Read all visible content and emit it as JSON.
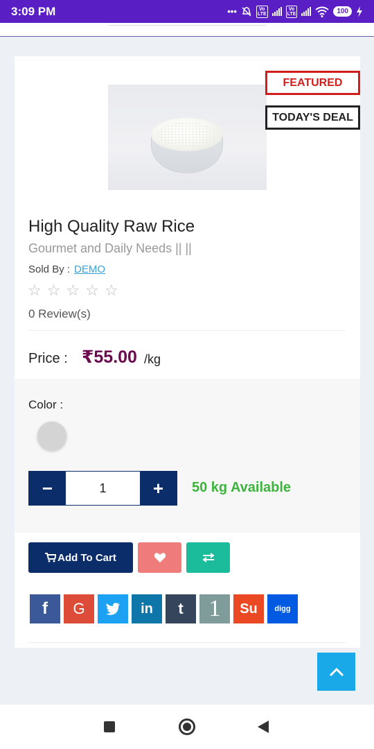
{
  "status_bar": {
    "time": "3:09 PM",
    "battery": "100",
    "volte_1": "Vo LTE",
    "volte_2": "Vo LTE",
    "icons": [
      "more-dots-icon",
      "mute-icon",
      "signal-icon",
      "signal-icon",
      "wifi-icon",
      "battery-icon",
      "charging-icon"
    ]
  },
  "product": {
    "image_icon": "rice-bowl-image",
    "badges": {
      "featured": "FEATURED",
      "todays_deal": "TODAY'S DEAL"
    },
    "title": "High Quality Raw Rice",
    "category": "Gourmet and Daily Needs || ||",
    "sold_by_label": "Sold By :",
    "seller": "DEMO",
    "rating": 0,
    "rating_max": 5,
    "reviews": "0 Review(s)",
    "price_label": "Price :",
    "price": "₹55.00",
    "price_unit": "/kg",
    "color_label": "Color :",
    "color_swatch": "#d4d4d4",
    "quantity": "1",
    "availability": "50 kg Available"
  },
  "actions": {
    "add_to_cart": "Add To Cart",
    "wishlist_icon": "heart-icon",
    "compare_icon": "compare-arrows-icon",
    "cart_icon": "cart-icon"
  },
  "share": [
    {
      "name": "facebook",
      "glyph": "f",
      "color": "#3b5998"
    },
    {
      "name": "google",
      "glyph": "G",
      "color": "#dd4b39"
    },
    {
      "name": "twitter",
      "glyph": "t",
      "color": "#1da1f2"
    },
    {
      "name": "linkedin",
      "glyph": "in",
      "color": "#0e76a8"
    },
    {
      "name": "tumblr",
      "glyph": "t",
      "color": "#35465c"
    },
    {
      "name": "onexhw",
      "glyph": "1",
      "color": "#7f9c9b"
    },
    {
      "name": "stumbleupon",
      "glyph": "Su",
      "color": "#eb4924"
    },
    {
      "name": "digg",
      "glyph": "digg",
      "color": "#005be2"
    }
  ],
  "colors": {
    "status_bar": "#5a1fc4",
    "navy": "#0b2d6a",
    "price": "#6b0a4e",
    "available": "#3db43d",
    "featured": "#d21d1d",
    "scroll_top": "#19a8e8"
  }
}
